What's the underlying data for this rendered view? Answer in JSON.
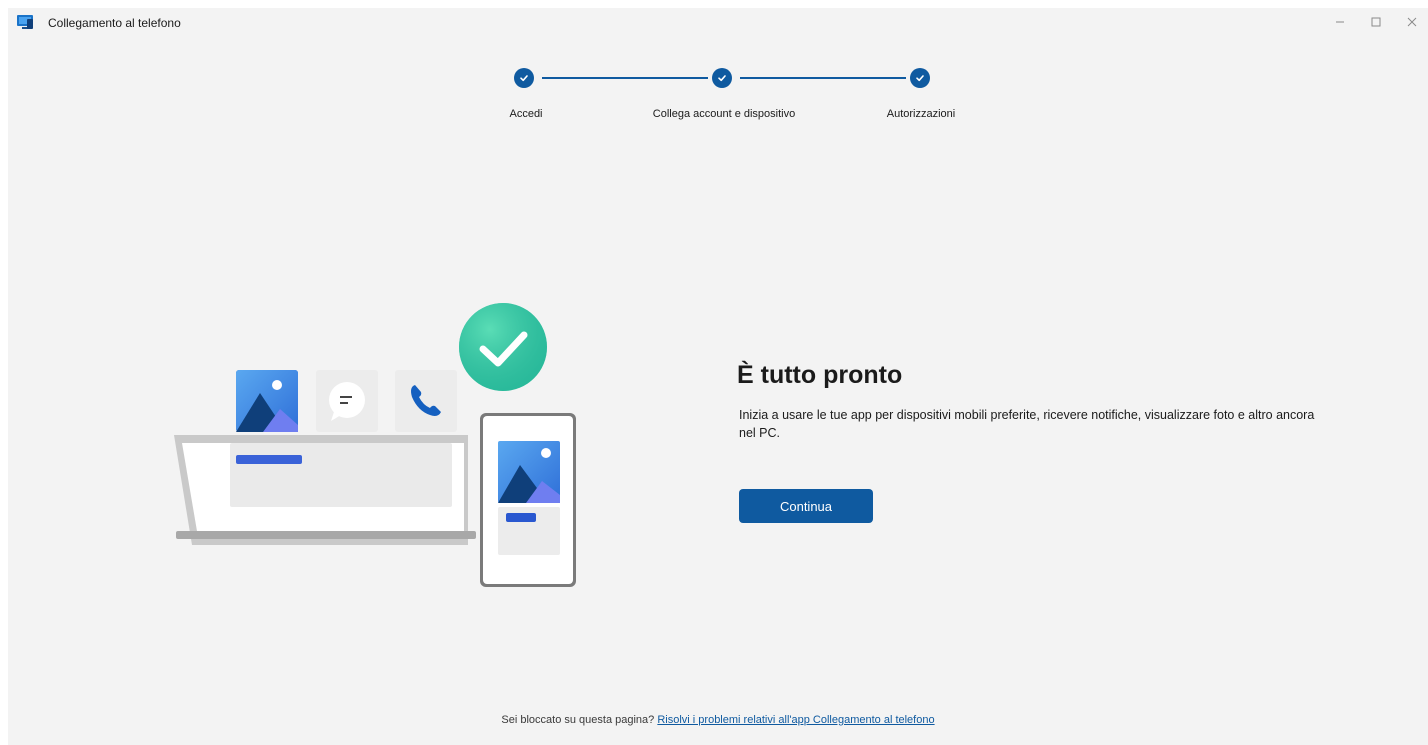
{
  "window": {
    "title": "Collegamento al telefono",
    "icon": "phone-link-app-icon",
    "controls": {
      "minimize": "–",
      "maximize": "☐",
      "close": "✕"
    }
  },
  "stepper": {
    "steps": [
      {
        "label": "Accedi",
        "status": "complete"
      },
      {
        "label": "Collega account e dispositivo",
        "status": "complete"
      },
      {
        "label": "Autorizzazioni",
        "status": "complete"
      }
    ],
    "accent": "#0f5aa0"
  },
  "main": {
    "heading": "È tutto pronto",
    "description": "Inizia a usare le tue app per dispositivi mobili preferite, ricevere notifiche, visualizzare foto e altro ancora nel PC.",
    "continue_label": "Continua"
  },
  "footer": {
    "prompt": "Sei bloccato su questa pagina?",
    "link": "Risolvi i problemi relativi all'app Collegamento al telefono"
  },
  "colors": {
    "accent": "#0f5aa0",
    "background": "#f3f3f3",
    "success": "#2ec4a0"
  }
}
